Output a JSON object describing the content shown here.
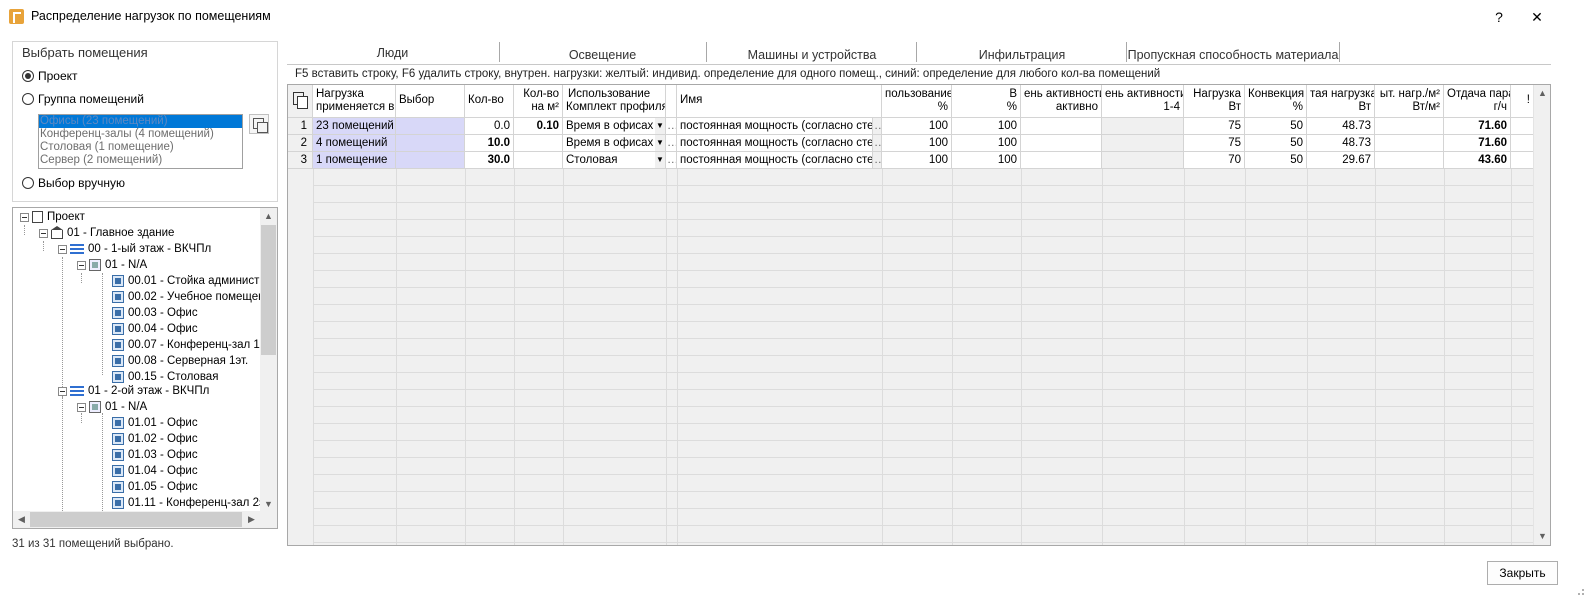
{
  "window": {
    "title": "Распределение нагрузок по помещениям",
    "help": "?",
    "close": "✕"
  },
  "left": {
    "group_title": "Выбрать помещения",
    "radio_project": "Проект",
    "radio_group": "Группа помещений",
    "radio_manual": "Выбор вручную",
    "groups": [
      "Офисы (23 помещений)",
      "Конференц-залы (4 помещений)",
      "Столовая (1 помещение)",
      "Сервер (2 помещений)"
    ],
    "status": "31 из 31 помещений выбрано."
  },
  "tree": {
    "project": "Проект",
    "building": "01 - Главное здание",
    "floor1": "00 - 1-ый этаж - ВКЧПл",
    "zone1": "01 - N/A",
    "rooms1": [
      "00.01 - Стойка администр",
      "00.02 - Учебное помещен",
      "00.03 - Офис",
      "00.04 - Офис",
      "00.07 - Конференц-зал 1э",
      "00.08 - Серверная 1эт.",
      "00.15 - Столовая"
    ],
    "floor2": "01 - 2-ой этаж - ВКЧПл",
    "zone2": "01 - N/A",
    "rooms2": [
      "01.01 - Офис",
      "01.02 - Офис",
      "01.03 - Офис",
      "01.04 - Офис",
      "01.05 - Офис",
      "01.11 - Конференц-зал 2э"
    ]
  },
  "tabs": [
    "Люди",
    "Освещение",
    "Машины и устройства",
    "Инфильтрация",
    "Пропускная способность материала"
  ],
  "hint": "F5 вставить строку, F6 удалить строку, внутрен. нагрузки: желтый: индивид. определение для одного помещ., синий: определение для любого кол-ва помещений",
  "grid": {
    "headers": {
      "applies_l1": "Нагрузка",
      "applies_l2": "применяется в",
      "choice": "Выбор",
      "count": "Кол-во",
      "per_m2_l1": "Кол-во",
      "per_m2_l2": "на м²",
      "usage_l1": "Использование",
      "usage_l2": "Комплект профиля",
      "name": "Имя",
      "use_pct_l1": "пользование",
      "use_pct_l2": "%",
      "col_b_l1": "В",
      "col_b_l2": "%",
      "day_active_l1": "ень активности",
      "day_active_l2": "активно",
      "day_active2_l1": "ень активности",
      "day_active2_l2": "1-4",
      "load_l1": "Нагрузка",
      "load_l2": "Вт",
      "convection_l1": "Конвекция",
      "convection_l2": "%",
      "sens_load_l1": "тая нагрузка",
      "sens_load_l2": "Вт",
      "spec_load_l1": "ыт. нагр./м²",
      "spec_load_l2": "Вт/м²",
      "vapor_l1": "Отдача пара",
      "vapor_l2": "г/ч",
      "warn": "!"
    },
    "rows": [
      {
        "n": "1",
        "applies": "23 помещений",
        "count": "0.0",
        "per_m2": "0.10",
        "profile": "Время в офисах",
        "name": "постоянная мощность (согласно сте...",
        "use_pct": "100",
        "b_pct": "100",
        "load": "75",
        "conv": "50",
        "sens": "48.73",
        "vapor": "71.60"
      },
      {
        "n": "2",
        "applies": "4 помещений",
        "count": "10.0",
        "per_m2": "",
        "profile": "Время в офисах",
        "name": "постоянная мощность (согласно сте...",
        "use_pct": "100",
        "b_pct": "100",
        "load": "75",
        "conv": "50",
        "sens": "48.73",
        "vapor": "71.60"
      },
      {
        "n": "3",
        "applies": "1 помещение",
        "count": "30.0",
        "per_m2": "",
        "profile": "Столовая",
        "name": "постоянная мощность (согласно сте...",
        "use_pct": "100",
        "b_pct": "100",
        "load": "70",
        "conv": "50",
        "sens": "29.67",
        "vapor": "43.60"
      }
    ]
  },
  "footer": {
    "close": "Закрыть"
  },
  "colors": {
    "selection": "#0078d7",
    "blue_cell": "#d8d8f8",
    "grid_bg": "#f0f0f0"
  }
}
